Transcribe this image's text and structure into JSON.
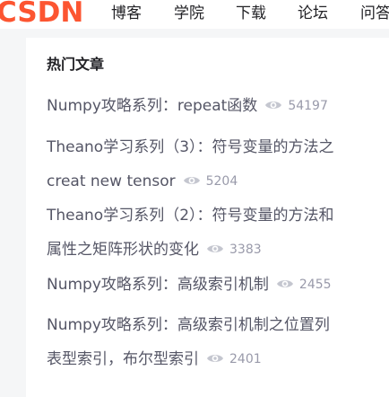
{
  "header": {
    "logo_text": "CSDN",
    "nav": [
      "博客",
      "学院",
      "下载",
      "论坛",
      "问答"
    ]
  },
  "panel": {
    "title": "热门文章",
    "articles": [
      {
        "lines": [
          "Numpy攻略系列：repeat函数"
        ],
        "views": "54197"
      },
      {
        "lines": [
          "Theano学习系列（3）：符号变量的方法之",
          "creat new tensor"
        ],
        "views": "5204"
      },
      {
        "lines": [
          "Theano学习系列（2）：符号变量的方法和",
          "属性之矩阵形状的变化"
        ],
        "views": "3383"
      },
      {
        "lines": [
          "Numpy攻略系列：高级索引机制"
        ],
        "views": "2455"
      },
      {
        "lines": [
          "Numpy攻略系列：高级索引机制之位置列",
          "表型索引，布尔型索引"
        ],
        "views": "2401"
      }
    ]
  },
  "colors": {
    "brand": "#fc5531",
    "title": "#222226",
    "article_text": "#555666",
    "views_text": "#999aaa"
  },
  "icons": {
    "views": "eye-icon"
  }
}
